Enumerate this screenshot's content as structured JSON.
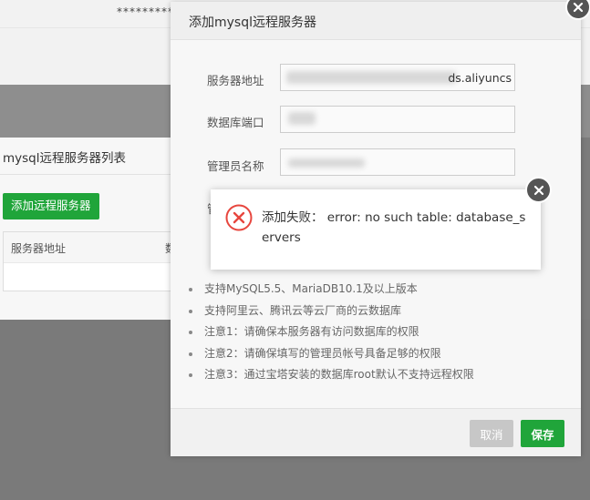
{
  "background": {
    "masked_text": "**********",
    "list_title": "mysql远程服务器列表",
    "add_button": "添加远程服务器",
    "table_headers": [
      "服务器地址",
      "数"
    ]
  },
  "dialog": {
    "title": "添加mysql远程服务器",
    "fields": {
      "server_address_label": "服务器地址",
      "server_address_value": "ds.aliyuncs",
      "port_label": "数据库端口",
      "admin_label": "管理员名称",
      "hidden_label": "管"
    },
    "notes": [
      "支持MySQL5.5、MariaDB10.1及以上版本",
      "支持阿里云、腾讯云等云厂商的云数据库",
      "注意1：请确保本服务器有访问数据库的权限",
      "注意2：请确保填写的管理员帐号具备足够的权限",
      "注意3：通过宝塔安装的数据库root默认不支持远程权限"
    ],
    "cancel_label": "取消",
    "save_label": "保存"
  },
  "message": {
    "text": "添加失败：  error: no such table: database_servers"
  },
  "colors": {
    "primary_green": "#20a53a",
    "error_red": "#e7463e",
    "close_dark": "#555555"
  },
  "icons": {
    "dialog_close": "close-icon",
    "message_close": "close-icon",
    "error": "error-circle-icon"
  }
}
